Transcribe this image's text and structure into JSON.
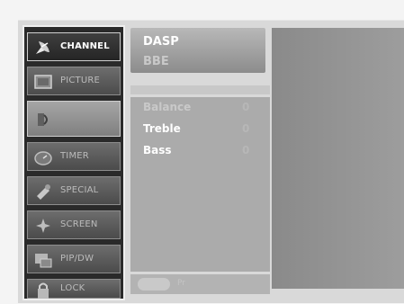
{
  "sidebar": {
    "items": [
      {
        "label": "CHANNEL",
        "icon": "satellite-dish-icon",
        "state": "active"
      },
      {
        "label": "PICTURE",
        "icon": "picture-icon",
        "state": "normal"
      },
      {
        "label": "",
        "icon": "speaker-icon",
        "state": "selected"
      },
      {
        "label": "TIMER",
        "icon": "timer-icon",
        "state": "normal"
      },
      {
        "label": "SPECIAL",
        "icon": "special-icon",
        "state": "normal"
      },
      {
        "label": "SCREEN",
        "icon": "screen-icon",
        "state": "normal"
      },
      {
        "label": "PIP/DW",
        "icon": "pip-icon",
        "state": "normal"
      },
      {
        "label": "LOCK",
        "icon": "lock-icon",
        "state": "normal"
      }
    ]
  },
  "submenu_top": {
    "items": [
      {
        "label": "DASP",
        "color": "#ffffff"
      },
      {
        "label": "BBE",
        "color": "#c9c9c9"
      }
    ]
  },
  "submenu_main": {
    "items": [
      {
        "label": "Balance",
        "value": "0",
        "label_color": "#c9c9c9"
      },
      {
        "label": "Treble",
        "value": "0",
        "label_color": "#ffffff"
      },
      {
        "label": "Bass",
        "value": "0",
        "label_color": "#ffffff"
      }
    ]
  },
  "bottom": {
    "text": "Pr"
  },
  "colors": {
    "active_bg": "#2f2f2f",
    "panel_bg": "#ababab",
    "sidebar_frame": "#efefef"
  }
}
